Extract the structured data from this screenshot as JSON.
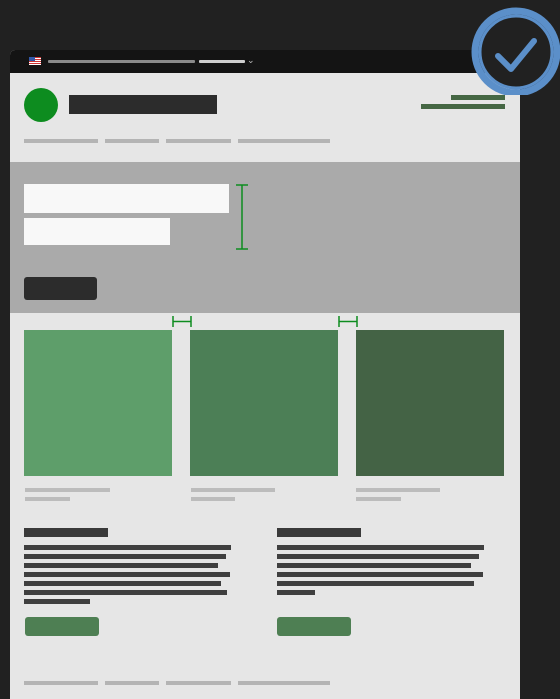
{
  "colors": {
    "background": "#212121",
    "page": "#e6e6e6",
    "topbar": "#141414",
    "logo": "#0d8c1f",
    "hero": "#aaaaaa",
    "card_1": "#5e9e6a",
    "card_2": "#4c7f56",
    "card_3": "#446345",
    "button_accent": "#4e7f53",
    "spacing_marker": "#0d8c1f",
    "check_badge": "#5b8fc9"
  },
  "icons": {
    "flag": "us-flag-icon",
    "language_dropdown": "chevron-down-icon",
    "badge": "checkmark-circle-icon"
  },
  "topbar": {
    "chevron": "⌄"
  },
  "nav": {
    "items": [
      "",
      "",
      "",
      ""
    ]
  },
  "hero": {
    "fields": [
      "",
      ""
    ],
    "button": ""
  },
  "cards": [
    {
      "caption": ""
    },
    {
      "caption": ""
    },
    {
      "caption": ""
    }
  ],
  "articles": [
    {
      "heading": "",
      "button": ""
    },
    {
      "heading": "",
      "button": ""
    }
  ],
  "footer": {
    "items": [
      "",
      "",
      "",
      ""
    ]
  }
}
